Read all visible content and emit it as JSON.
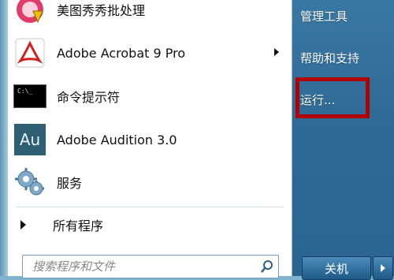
{
  "programs": [
    {
      "label": "美图秀秀批处理",
      "icon": "meitu-batch-icon",
      "has_submenu": false
    },
    {
      "label": "Adobe Acrobat 9 Pro",
      "icon": "adobe-acrobat-icon",
      "has_submenu": true
    },
    {
      "label": "命令提示符",
      "icon": "command-prompt-icon",
      "has_submenu": false
    },
    {
      "label": "Adobe Audition 3.0",
      "icon": "adobe-audition-icon",
      "has_submenu": false
    },
    {
      "label": "服务",
      "icon": "services-gear-icon",
      "has_submenu": false
    }
  ],
  "all_programs_label": "所有程序",
  "search": {
    "placeholder": "搜索程序和文件"
  },
  "right_menu": {
    "admin_tools": "管理工具",
    "help_support": "帮助和支持",
    "run": "运行..."
  },
  "shutdown_label": "关机",
  "colors": {
    "highlight_border": "#b00000",
    "right_panel": "#2f6b97",
    "audition_icon": "#2f5f73"
  },
  "icon_texts": {
    "cmd": "C:\\_",
    "audition": "Au"
  }
}
